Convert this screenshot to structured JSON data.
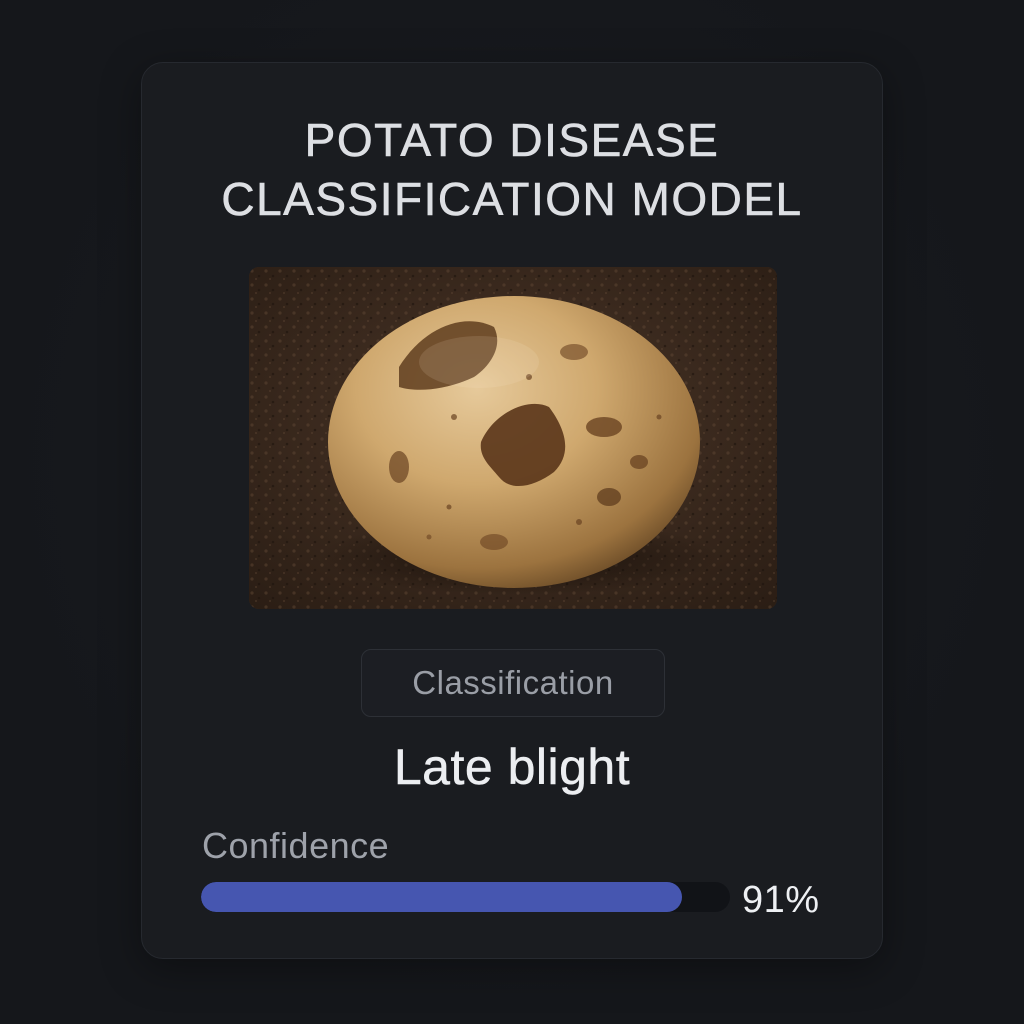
{
  "card": {
    "title_line1": "POTATO DISEASE",
    "title_line2": "CLASSIFICATION MODEL"
  },
  "image": {
    "subject": "potato with dark blight lesions on soil"
  },
  "classification": {
    "label": "Classification",
    "result": "Late blight"
  },
  "confidence": {
    "label": "Confidence",
    "value": 0.91,
    "display": "91%"
  },
  "colors": {
    "background": "#15171b",
    "card": "#1a1c20",
    "accent_bar": "#4656b0"
  }
}
